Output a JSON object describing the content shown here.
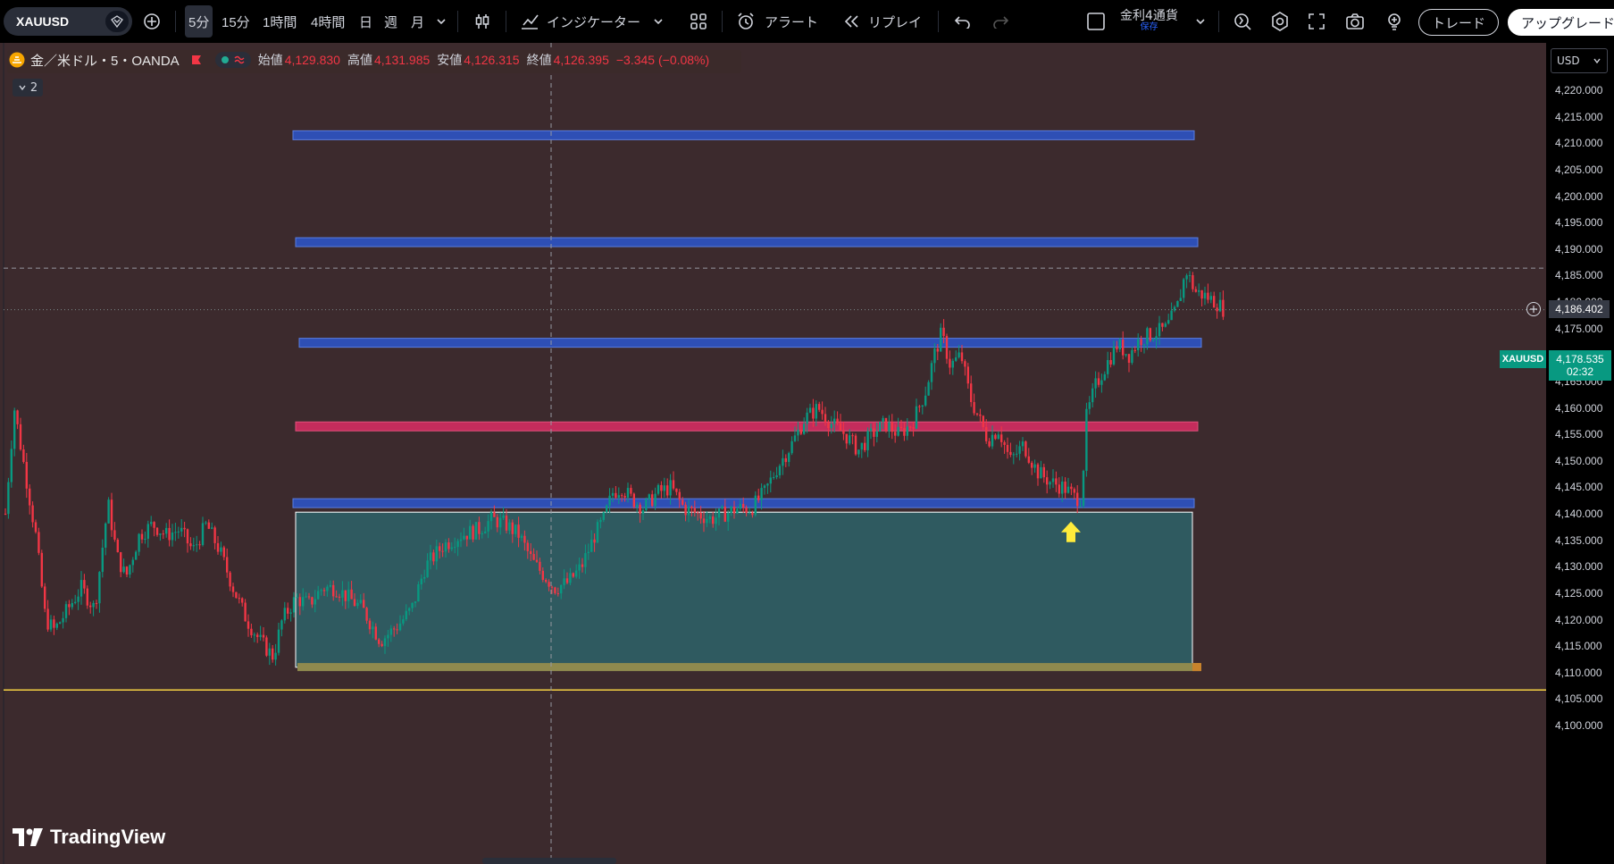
{
  "toolbar": {
    "symbol": "XAUUSD",
    "timeframes": [
      "5分",
      "15分",
      "1時間",
      "4時間",
      "日",
      "週",
      "月"
    ],
    "active_timeframe": "5分",
    "indicators_label": "インジケーター",
    "alert_label": "アラート",
    "replay_label": "リプレイ",
    "layout_name": "金利4通貨",
    "layout_status": "保存",
    "trade_label": "トレード",
    "upgrade_label": "アップグレード"
  },
  "legend": {
    "title": "金／米ドル・5・OANDA",
    "open_label": "始値",
    "open": "4,129.830",
    "high_label": "高値",
    "high": "4,131.985",
    "low_label": "安値",
    "low": "4,126.315",
    "close_label": "終値",
    "close": "4,126.395",
    "change": "−3.345 (−0.08%)",
    "collapse_count": "2"
  },
  "axis": {
    "currency": "USD",
    "ticks": [
      "4,220.000",
      "4,215.000",
      "4,210.000",
      "4,205.000",
      "4,200.000",
      "4,195.000",
      "4,190.000",
      "4,185.000",
      "4,180.000",
      "4,175.000",
      "4,170.000",
      "4,165.000",
      "4,160.000",
      "4,155.000",
      "4,150.000",
      "4,145.000",
      "4,140.000",
      "4,135.000",
      "4,130.000",
      "4,125.000",
      "4,120.000",
      "4,115.000",
      "4,110.000",
      "4,105.000",
      "4,100.000"
    ],
    "crosshair_price": "4,186.402",
    "last_price": "4,178.535",
    "countdown": "02:32",
    "price_symbol": "XAUUSD"
  },
  "colors": {
    "chart_bg": "#3c2a2d",
    "level_blue": "#2e4fb5",
    "level_red": "#c42c5c",
    "zone_fill": "#2f5a60",
    "bull": "#089981",
    "bear": "#f23645",
    "support_line": "#f5d142",
    "arrow": "#ffeb3b"
  },
  "branding": {
    "logo_text": "TradingView"
  },
  "chart_data": {
    "type": "candlestick",
    "ylim": [
      4098,
      4224
    ],
    "horizontal_levels": [
      {
        "name": "",
        "price": 4211.5,
        "color": "blue"
      },
      {
        "name": "",
        "price": 4191.3,
        "color": "blue"
      },
      {
        "name": "",
        "price": 4172.3,
        "color": "blue"
      },
      {
        "name": "",
        "price": 4156.5,
        "color": "red"
      },
      {
        "name": "",
        "price": 4142.0,
        "color": "blue"
      }
    ],
    "zone": {
      "low": 4111.0,
      "high": 4140.3
    },
    "support_line": 4106.7,
    "crosshair_price": 4186.402,
    "last_price": 4178.535,
    "price_path": [
      [
        0,
        4140
      ],
      [
        10,
        4160
      ],
      [
        22,
        4148
      ],
      [
        34,
        4136
      ],
      [
        45,
        4120
      ],
      [
        55,
        4118
      ],
      [
        70,
        4122
      ],
      [
        85,
        4126
      ],
      [
        100,
        4122
      ],
      [
        115,
        4142
      ],
      [
        125,
        4132
      ],
      [
        135,
        4128
      ],
      [
        150,
        4136
      ],
      [
        165,
        4138
      ],
      [
        180,
        4136
      ],
      [
        195,
        4137
      ],
      [
        210,
        4133
      ],
      [
        225,
        4138
      ],
      [
        240,
        4133
      ],
      [
        255,
        4126
      ],
      [
        270,
        4120
      ],
      [
        285,
        4116
      ],
      [
        300,
        4113
      ],
      [
        310,
        4120
      ],
      [
        325,
        4124
      ],
      [
        340,
        4123
      ],
      [
        355,
        4126
      ],
      [
        370,
        4126
      ],
      [
        385,
        4124
      ],
      [
        400,
        4122
      ],
      [
        420,
        4116
      ],
      [
        440,
        4119
      ],
      [
        455,
        4122
      ],
      [
        470,
        4130
      ],
      [
        490,
        4134
      ],
      [
        510,
        4136
      ],
      [
        530,
        4137
      ],
      [
        545,
        4139
      ],
      [
        560,
        4138
      ],
      [
        575,
        4136
      ],
      [
        590,
        4131
      ],
      [
        605,
        4128
      ],
      [
        615,
        4126
      ],
      [
        630,
        4127
      ],
      [
        645,
        4130
      ],
      [
        660,
        4136
      ],
      [
        670,
        4139
      ],
      [
        680,
        4144
      ],
      [
        690,
        4145
      ],
      [
        700,
        4143
      ],
      [
        715,
        4141
      ],
      [
        730,
        4144
      ],
      [
        745,
        4145
      ],
      [
        760,
        4141
      ],
      [
        775,
        4140
      ],
      [
        790,
        4139
      ],
      [
        805,
        4140
      ],
      [
        820,
        4141
      ],
      [
        835,
        4141
      ],
      [
        850,
        4144
      ],
      [
        865,
        4149
      ],
      [
        880,
        4153
      ],
      [
        895,
        4158
      ],
      [
        910,
        4160
      ],
      [
        925,
        4157
      ],
      [
        940,
        4155
      ],
      [
        955,
        4152
      ],
      [
        970,
        4155
      ],
      [
        985,
        4157
      ],
      [
        1000,
        4155
      ],
      [
        1015,
        4157
      ],
      [
        1030,
        4163
      ],
      [
        1040,
        4170
      ],
      [
        1048,
        4174
      ],
      [
        1058,
        4168
      ],
      [
        1070,
        4170
      ],
      [
        1080,
        4162
      ],
      [
        1090,
        4158
      ],
      [
        1100,
        4154
      ],
      [
        1112,
        4156
      ],
      [
        1125,
        4150
      ],
      [
        1140,
        4153
      ],
      [
        1155,
        4148
      ],
      [
        1170,
        4146
      ],
      [
        1185,
        4145
      ],
      [
        1198,
        4143
      ],
      [
        1205,
        4143
      ],
      [
        1210,
        4158
      ],
      [
        1220,
        4164
      ],
      [
        1232,
        4168
      ],
      [
        1245,
        4172
      ],
      [
        1258,
        4170
      ],
      [
        1270,
        4173
      ],
      [
        1285,
        4174
      ],
      [
        1300,
        4175
      ],
      [
        1312,
        4179
      ],
      [
        1322,
        4186
      ],
      [
        1332,
        4182
      ],
      [
        1345,
        4181
      ],
      [
        1355,
        4180
      ],
      [
        1365,
        4178.5
      ]
    ]
  }
}
